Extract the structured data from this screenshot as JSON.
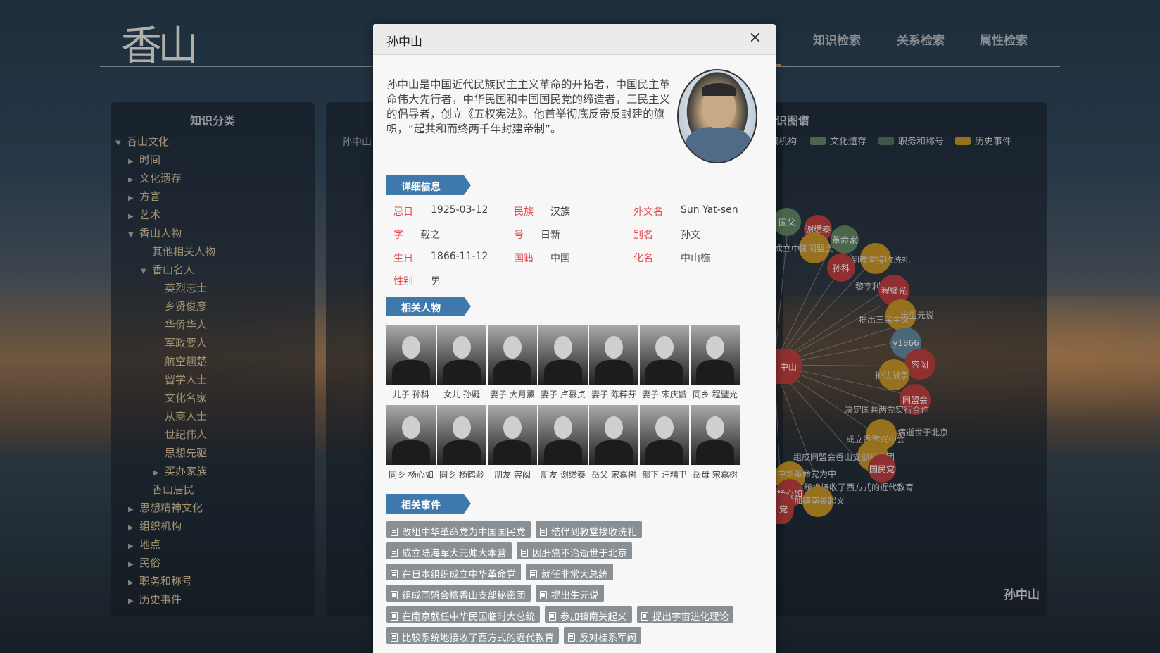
{
  "logo_text": "香山",
  "nav": {
    "items": [
      "知识检索",
      "关系检索",
      "属性检索"
    ]
  },
  "sidebar": {
    "title": "知识分类",
    "tree": [
      {
        "label": "香山文化",
        "level": 0,
        "expanded": true
      },
      {
        "label": "时间",
        "level": 1
      },
      {
        "label": "文化遗存",
        "level": 1
      },
      {
        "label": "方言",
        "level": 1
      },
      {
        "label": "艺术",
        "level": 1
      },
      {
        "label": "香山人物",
        "level": 1,
        "expanded": true
      },
      {
        "label": "其他相关人物",
        "level": 2,
        "leaf": true
      },
      {
        "label": "香山名人",
        "level": 2,
        "expanded": true
      },
      {
        "label": "英烈志士",
        "level": 3,
        "leaf": true
      },
      {
        "label": "乡贤俊彦",
        "level": 3,
        "leaf": true
      },
      {
        "label": "华侨华人",
        "level": 3,
        "leaf": true
      },
      {
        "label": "军政要人",
        "level": 3,
        "leaf": true
      },
      {
        "label": "航空翘楚",
        "level": 3,
        "leaf": true
      },
      {
        "label": "留学人士",
        "level": 3,
        "leaf": true
      },
      {
        "label": "文化名家",
        "level": 3,
        "leaf": true
      },
      {
        "label": "从商人士",
        "level": 3,
        "leaf": true
      },
      {
        "label": "世纪伟人",
        "level": 3,
        "leaf": true
      },
      {
        "label": "思想先驱",
        "level": 3,
        "leaf": true
      },
      {
        "label": "买办家族",
        "level": 3
      },
      {
        "label": "香山居民",
        "level": 2,
        "leaf": true
      },
      {
        "label": "思想精神文化",
        "level": 1
      },
      {
        "label": "组织机构",
        "level": 1
      },
      {
        "label": "地点",
        "level": 1
      },
      {
        "label": "民俗",
        "level": 1
      },
      {
        "label": "职务和称号",
        "level": 1
      },
      {
        "label": "历史事件",
        "level": 1
      }
    ]
  },
  "middle_panel": {
    "breadcrumb": "孙中山"
  },
  "graph_panel": {
    "title": "知识图谱",
    "title_visible": "识图谱",
    "legend": [
      {
        "label": "织机构",
        "color": "#5c7f93"
      },
      {
        "label": "文化遗存",
        "color": "#5b7d5d"
      },
      {
        "label": "职务和称号",
        "color": "#4f6a57"
      },
      {
        "label": "历史事件",
        "color": "#b98a24"
      }
    ],
    "footer_name": "孙中山",
    "node_labels": [
      "国父",
      "谢缵泰",
      "革命家",
      "成立中国同盟会",
      "结伴到教堂接收洗礼",
      "孙科",
      "黎亨利",
      "程璧光",
      "提出三民主义",
      "出生元说",
      "y1866",
      "中山",
      "容闳",
      "护法战争",
      "同盟会",
      "决定国共两党实行合作",
      "病逝世于北京",
      "成立香港兴中会",
      "组成同盟会香山支部秘密团",
      "国民党",
      "中华革命党为中",
      "统地接收了西方式的近代教育",
      "杨心如",
      "参加镇南关起义",
      "党"
    ]
  },
  "modal": {
    "title": "孙中山",
    "close_label": "×",
    "intro": "孙中山是中国近代民族民主主义革命的开拓者，中国民主革命伟大先行者，中华民国和中国国民党的缔造者，三民主义的倡导者，创立《五权宪法》。他首举彻底反帝反封建的旗帜，“起共和而终两千年封建帝制”。",
    "section_details": "详细信息",
    "section_people": "相关人物",
    "section_events": "相关事件",
    "details": [
      {
        "label": "忌日",
        "value": "1925-03-12"
      },
      {
        "label": "民族",
        "value": "汉族"
      },
      {
        "label": "外文名",
        "value": "Sun Yat-sen"
      },
      {
        "label": "字",
        "value": "载之"
      },
      {
        "label": "号",
        "value": "日新"
      },
      {
        "label": "别名",
        "value": "孙文"
      },
      {
        "label": "生日",
        "value": "1866-11-12"
      },
      {
        "label": "国籍",
        "value": "中国"
      },
      {
        "label": "化名",
        "value": "中山樵"
      },
      {
        "label": "性别",
        "value": "男"
      }
    ],
    "people": [
      "儿子 孙科",
      "女儿 孙娫",
      "妻子 大月薰",
      "妻子 卢慕贞",
      "妻子 陈粹芬",
      "妻子 宋庆龄",
      "同乡 程璧光",
      "同乡 杨心如",
      "同乡 杨鹤龄",
      "朋友 容闳",
      "朋友 谢缵泰",
      "岳父 宋嘉树",
      "部下 汪精卫",
      "岳母 宋嘉树"
    ],
    "events": [
      [
        "改组中华革命党为中国国民党",
        "结伴到教堂接收洗礼"
      ],
      [
        "成立陆海军大元帅大本营",
        "因肝癌不治逝世于北京"
      ],
      [
        "在日本组织成立中华革命党",
        "就任非常大总统"
      ],
      [
        "组成同盟会檀香山支部秘密团",
        "提出生元说"
      ],
      [
        "在南京就任中华民国临时大总统",
        "参加镇南关起义",
        "提出宇宙进化理论"
      ],
      [
        "比较系统地接收了西方式的近代教育",
        "反对桂系军阀"
      ]
    ]
  }
}
